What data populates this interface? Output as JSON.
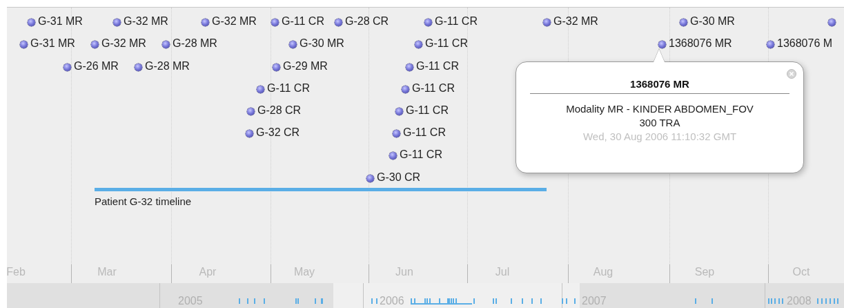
{
  "timeline": {
    "events": [
      {
        "kind": "labelled",
        "label": "G-31 MR"
      },
      {
        "kind": "labelled",
        "label": "G-32 MR"
      },
      {
        "kind": "labelled",
        "label": "G-32 MR"
      },
      {
        "kind": "labelled",
        "label": "G-11 CR"
      },
      {
        "kind": "labelled",
        "label": "G-28 CR"
      },
      {
        "kind": "labelled",
        "label": "G-11 CR"
      },
      {
        "kind": "labelled",
        "label": "G-32 MR"
      },
      {
        "kind": "labelled",
        "label": "G-30 MR"
      },
      {
        "kind": "point"
      },
      {
        "kind": "labelled",
        "label": "G-31 MR"
      },
      {
        "kind": "labelled",
        "label": "G-32 MR"
      },
      {
        "kind": "labelled",
        "label": "G-28 MR"
      },
      {
        "kind": "labelled",
        "label": "G-30 MR"
      },
      {
        "kind": "labelled",
        "label": "G-11 CR"
      },
      {
        "kind": "labelled",
        "label": "1368076 MR"
      },
      {
        "kind": "labelled",
        "label": "1368076 M"
      },
      {
        "kind": "labelled",
        "label": "G-26 MR"
      },
      {
        "kind": "labelled",
        "label": "G-28 MR"
      },
      {
        "kind": "labelled",
        "label": "G-29 MR"
      },
      {
        "kind": "labelled",
        "label": "G-11 CR"
      },
      {
        "kind": "labelled",
        "label": "G-11 CR"
      },
      {
        "kind": "labelled",
        "label": "G-11 CR"
      },
      {
        "kind": "labelled",
        "label": "G-28 CR"
      },
      {
        "kind": "labelled",
        "label": "G-11 CR"
      },
      {
        "kind": "labelled",
        "label": "G-32 CR"
      },
      {
        "kind": "labelled",
        "label": "G-11 CR"
      },
      {
        "kind": "labelled",
        "label": "G-11 CR"
      },
      {
        "kind": "labelled",
        "label": "G-30 CR"
      }
    ],
    "duration_bar": {
      "label": "Patient G-32 timeline"
    },
    "months": [
      "Feb",
      "Mar",
      "Apr",
      "May",
      "Jun",
      "Jul",
      "Aug",
      "Sep",
      "Oct"
    ],
    "overview": {
      "years": [
        "2005",
        "2006",
        "2007",
        "2008"
      ]
    }
  },
  "popup": {
    "title": "1368076 MR",
    "description": "Modality MR - KINDER ABDOMEN_FOV 300 TRA",
    "date": "Wed, 30 Aug 2006 11:10:32 GMT"
  }
}
